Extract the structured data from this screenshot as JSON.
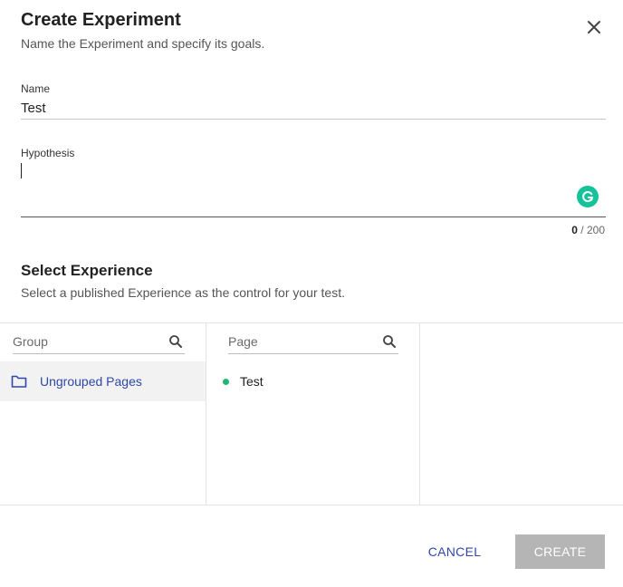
{
  "dialog": {
    "title": "Create Experiment",
    "subtitle": "Name the Experiment and specify its goals.",
    "close_icon": "close-icon"
  },
  "name_field": {
    "label": "Name",
    "value": "Test"
  },
  "hypothesis_field": {
    "label": "Hypothesis",
    "value": "",
    "counter_current": "0",
    "counter_sep_max": " / 200",
    "assistant_icon": "grammarly-icon"
  },
  "experience": {
    "title": "Select Experience",
    "subtitle": "Select a published Experience as the control for your test.",
    "group_column": {
      "search_placeholder": "Group",
      "items": [
        {
          "label": "Ungrouped Pages",
          "icon": "folder-icon",
          "selected": true
        }
      ]
    },
    "page_column": {
      "search_placeholder": "Page",
      "items": [
        {
          "label": "Test",
          "status_color": "#22b573"
        }
      ]
    }
  },
  "footer": {
    "cancel_label": "CANCEL",
    "create_label": "CREATE"
  },
  "colors": {
    "accent": "#2f48a8",
    "disabled_button": "#b5b5b5",
    "grammarly": "#15c39a",
    "status_published": "#22b573"
  }
}
